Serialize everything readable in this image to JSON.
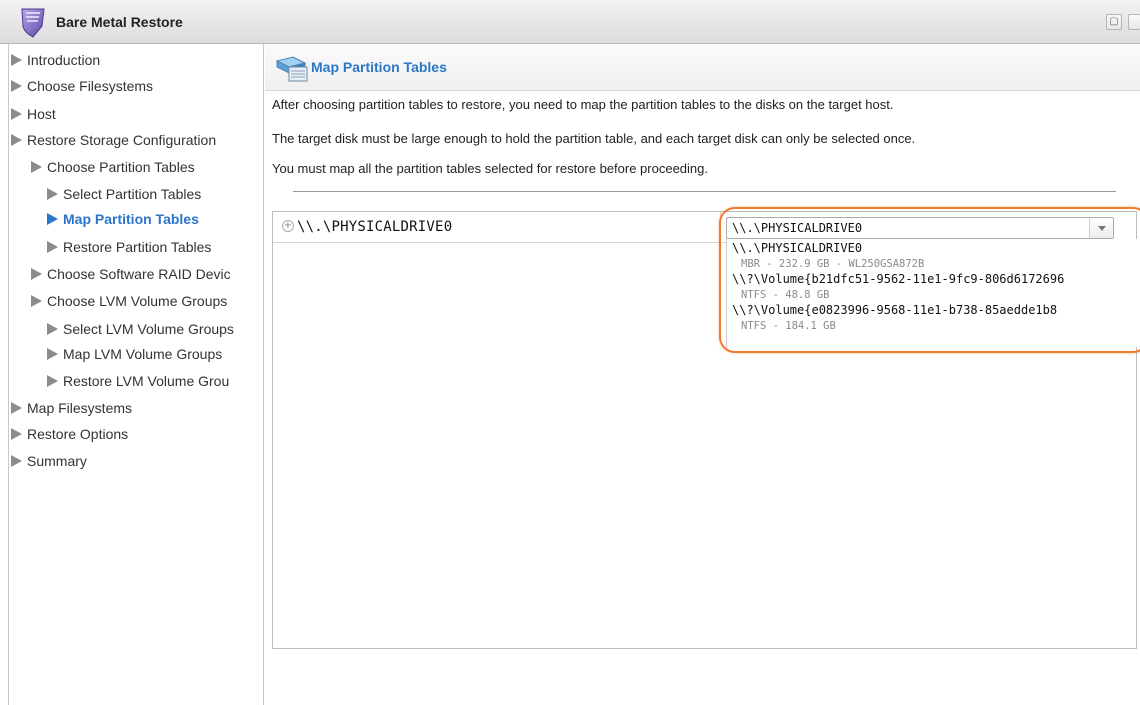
{
  "window": {
    "title": "Bare Metal Restore",
    "icon": "shield-icon"
  },
  "sidebar": {
    "items": [
      {
        "label": "Introduction",
        "level": 0,
        "active": false
      },
      {
        "label": "Choose Filesystems",
        "level": 0,
        "active": false
      },
      {
        "label": "Host",
        "level": 0,
        "active": false
      },
      {
        "label": "Restore Storage Configuration",
        "level": 0,
        "active": false
      },
      {
        "label": "Choose Partition Tables",
        "level": 1,
        "active": false
      },
      {
        "label": "Select Partition Tables",
        "level": 2,
        "active": false
      },
      {
        "label": "Map Partition Tables",
        "level": 2,
        "active": true
      },
      {
        "label": "Restore Partition Tables",
        "level": 2,
        "active": false
      },
      {
        "label": "Choose Software RAID Devic",
        "level": 1,
        "active": false
      },
      {
        "label": "Choose LVM Volume Groups",
        "level": 1,
        "active": false
      },
      {
        "label": "Select LVM Volume Groups",
        "level": 2,
        "active": false
      },
      {
        "label": "Map LVM Volume Groups",
        "level": 2,
        "active": false
      },
      {
        "label": "Restore LVM Volume Grou",
        "level": 2,
        "active": false
      },
      {
        "label": "Map Filesystems",
        "level": 0,
        "active": false
      },
      {
        "label": "Restore Options",
        "level": 0,
        "active": false
      },
      {
        "label": "Summary",
        "level": 0,
        "active": false
      }
    ]
  },
  "main": {
    "title": "Map Partition Tables",
    "descriptions": [
      "After choosing partition tables to restore, you need to map the partition tables to the disks on the target host.",
      "The target disk must be large enough to hold the partition table, and each target disk can only be selected once.",
      "You must map all the partition tables selected for restore before proceeding."
    ],
    "mapping": {
      "expand_symbol": "+",
      "source_disk": "\\\\.\\PHYSICALDRIVE0",
      "selected_target": "\\\\.\\PHYSICALDRIVE0",
      "options": [
        {
          "name": "\\\\.\\PHYSICALDRIVE0",
          "detail": "MBR - 232.9 GB - WL250GSA872B"
        },
        {
          "name": "\\\\?\\Volume{b21dfc51-9562-11e1-9fc9-806d6172696",
          "detail": "NTFS - 48.8 GB"
        },
        {
          "name": "\\\\?\\Volume{e0823996-9568-11e1-b738-85aedde1b8",
          "detail": "NTFS - 184.1 GB"
        }
      ]
    }
  },
  "colors": {
    "accent": "#2b74c9",
    "highlight": "#f07a30"
  }
}
